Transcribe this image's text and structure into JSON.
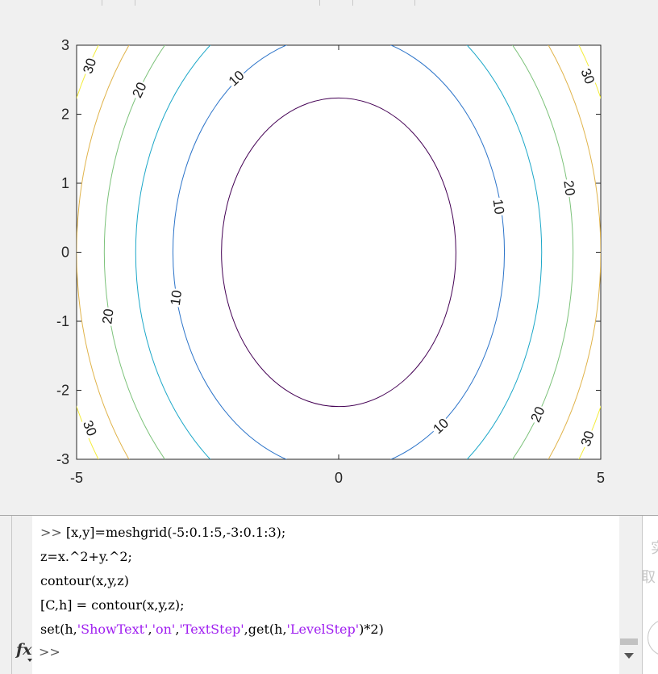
{
  "colors": {
    "figure_bg": "#f0f0f0",
    "axes_bg": "#ffffff",
    "string_literal": "#a020f0",
    "contour_levels": {
      "5": "#440154",
      "10": "#2c74c9",
      "15": "#1ca7c8",
      "20": "#7cc27a",
      "25": "#e0b34a",
      "30": "#f3ec3a"
    }
  },
  "chart_data": {
    "type": "contour",
    "function": "z = x.^2 + y.^2",
    "xlim": [
      -5,
      5
    ],
    "ylim": [
      -3,
      3
    ],
    "x_ticks": [
      -5,
      0,
      5
    ],
    "y_ticks": [
      3,
      2,
      1,
      0,
      -1,
      -2,
      -3
    ],
    "levels": [
      5,
      10,
      15,
      20,
      25,
      30
    ],
    "labeled_levels": [
      10,
      20,
      30
    ],
    "contour_labels": [
      {
        "text": "30",
        "x": -4.75,
        "y": 2.7,
        "angle": -72
      },
      {
        "text": "20",
        "x": -3.8,
        "y": 2.35,
        "angle": -65
      },
      {
        "text": "10",
        "x": -1.95,
        "y": 2.52,
        "angle": -42
      },
      {
        "text": "30",
        "x": 4.75,
        "y": 2.55,
        "angle": 68
      },
      {
        "text": "20",
        "x": 4.4,
        "y": 0.93,
        "angle": 82
      },
      {
        "text": "10",
        "x": 3.05,
        "y": 0.66,
        "angle": 82
      },
      {
        "text": "10",
        "x": -3.1,
        "y": -0.66,
        "angle": -82
      },
      {
        "text": "20",
        "x": -4.4,
        "y": -0.93,
        "angle": -82
      },
      {
        "text": "30",
        "x": -4.75,
        "y": -2.55,
        "angle": 68
      },
      {
        "text": "10",
        "x": 1.95,
        "y": -2.52,
        "angle": -42
      },
      {
        "text": "20",
        "x": 3.8,
        "y": -2.35,
        "angle": -65
      },
      {
        "text": "30",
        "x": 4.75,
        "y": -2.7,
        "angle": -72
      }
    ]
  },
  "command_window": {
    "lines": [
      [
        {
          "t": ">> ",
          "k": "prompt"
        },
        {
          "t": "[x,y]=meshgrid(-5:0.1:5,-3:0.1:3);",
          "k": "code"
        }
      ],
      [
        {
          "t": "z=x.^2+y.^2;",
          "k": "code"
        }
      ],
      [
        {
          "t": "contour(x,y,z)",
          "k": "code"
        }
      ],
      [
        {
          "t": "[C,h] = contour(x,y,z);",
          "k": "code"
        }
      ],
      [
        {
          "t": "set(h,",
          "k": "code"
        },
        {
          "t": "'ShowText'",
          "k": "str"
        },
        {
          "t": ",",
          "k": "code"
        },
        {
          "t": "'on'",
          "k": "str"
        },
        {
          "t": ",",
          "k": "code"
        },
        {
          "t": "'TextStep'",
          "k": "str"
        },
        {
          "t": ",get(h,",
          "k": "code"
        },
        {
          "t": "'LevelStep'",
          "k": "str"
        },
        {
          "t": ")*2)",
          "k": "code"
        }
      ]
    ],
    "prompt": ">>",
    "fx_icon": "function-browser-icon"
  },
  "right_panel": {
    "glyph_1": "实",
    "glyph_2": "取"
  }
}
